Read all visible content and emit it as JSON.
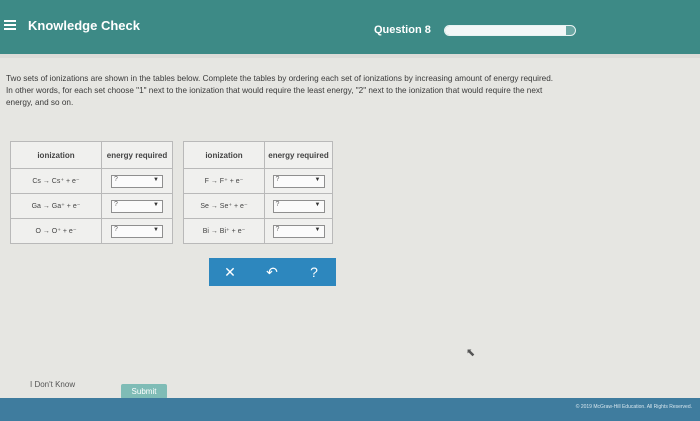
{
  "header": {
    "app_title": "Knowledge Check",
    "question_label": "Question 8",
    "progress": 0.93
  },
  "instructions": {
    "line1": "Two sets of ionizations are shown in the tables below. Complete the tables by ordering each set of ionizations by increasing amount of energy required.",
    "line2": "In other words, for each set choose \"1\" next to the ionization that would require the least energy, \"2\" next to the ionization that would require the next",
    "line3": "energy, and so on."
  },
  "tables": [
    {
      "header_ionization": "ionization",
      "header_energy": "energy required",
      "rows": [
        {
          "ionization": "Cs → Cs⁺ + e⁻",
          "selected": "?"
        },
        {
          "ionization": "Ga → Ga⁺ + e⁻",
          "selected": "?"
        },
        {
          "ionization": "O → O⁺ + e⁻",
          "selected": "?"
        }
      ]
    },
    {
      "header_ionization": "ionization",
      "header_energy": "energy required",
      "rows": [
        {
          "ionization": "F → F⁺ + e⁻",
          "selected": "?"
        },
        {
          "ionization": "Se → Se⁺ + e⁻",
          "selected": "?"
        },
        {
          "ionization": "Bi → Bi⁺ + e⁻",
          "selected": "?"
        }
      ]
    }
  ],
  "tools": {
    "clear": "✕",
    "undo": "↶",
    "help": "?"
  },
  "footer": {
    "dont_know": "I Don't Know",
    "submit": "Submit",
    "copyright": "© 2019 McGraw-Hill Education. All Rights Reserved."
  },
  "icons": {
    "menu": "menu-icon",
    "cursor": "mouse-cursor-icon"
  },
  "colors": {
    "header": "#3d8a86",
    "tools": "#2d87be",
    "footer": "#3f7c9e"
  }
}
